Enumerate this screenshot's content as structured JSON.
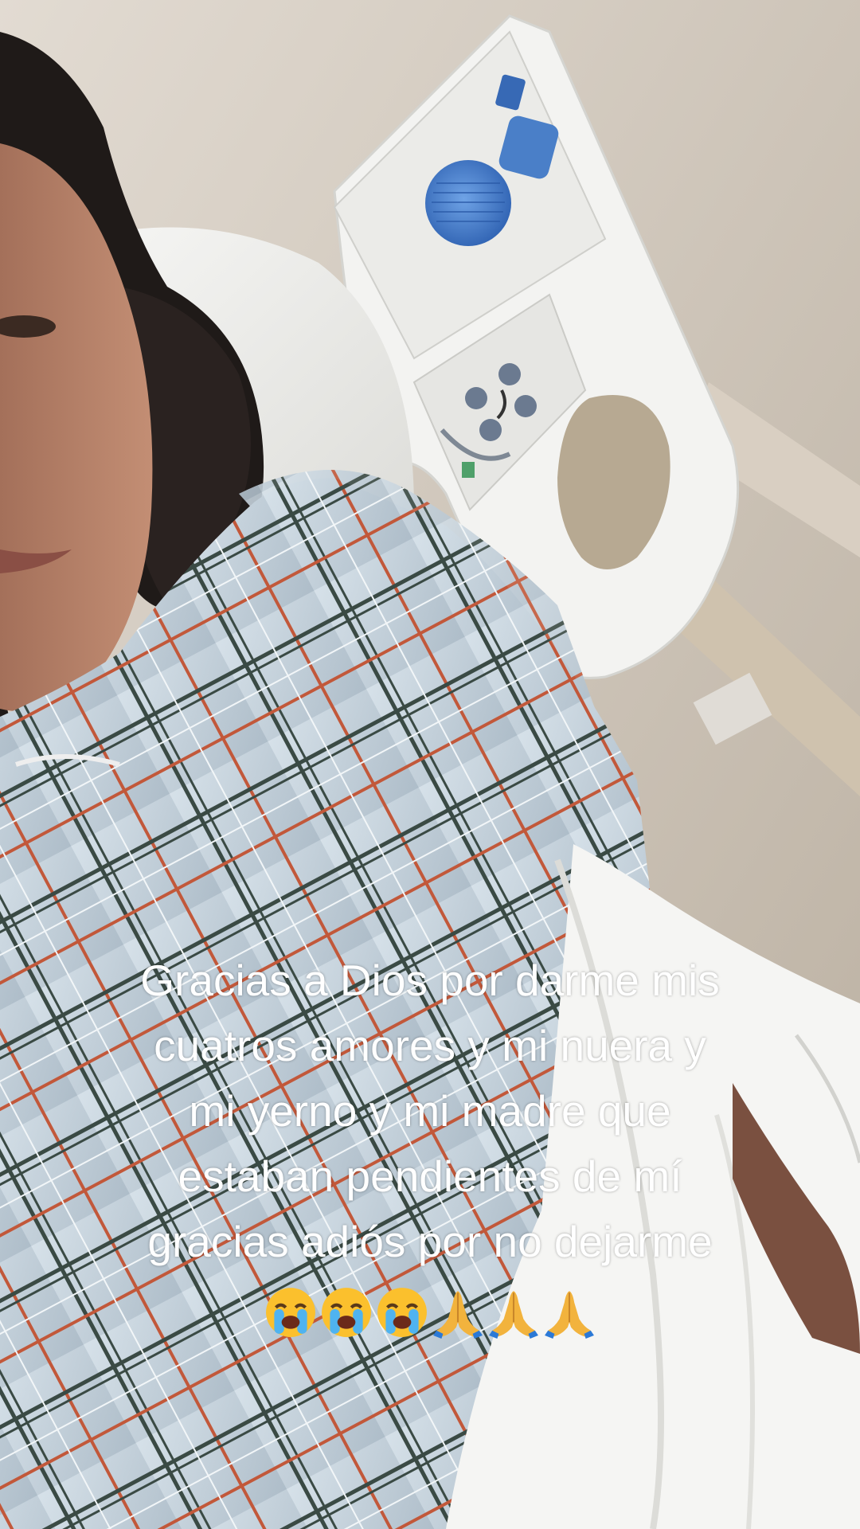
{
  "caption": {
    "lines": [
      "Gracias a Dios por darme mis",
      "cuatros amores y mi nuera y",
      "mi yerno y mi madre que",
      "estaban pendientes de mí",
      "gracias adiós por no dejarme"
    ],
    "emojis": [
      "crying-face-emoji",
      "crying-face-emoji",
      "crying-face-emoji",
      "folded-hands-emoji",
      "folded-hands-emoji",
      "folded-hands-emoji"
    ]
  },
  "colors": {
    "wall": "#d8d0c6",
    "bed_rail": "#f2f2f0",
    "gown": "#c9d6e0",
    "gown_stripe_dark": "#3a4a44",
    "gown_stripe_red": "#c2583a",
    "sheet": "#f5f5f3",
    "call_button_blue": "#4a7fc8"
  }
}
